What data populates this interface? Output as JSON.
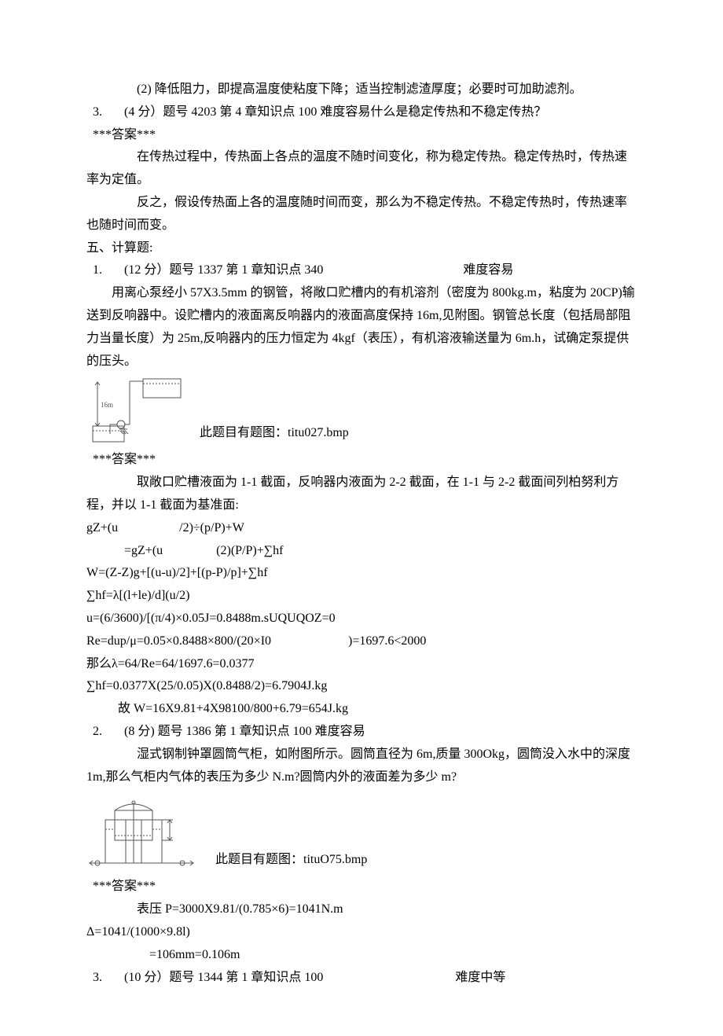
{
  "l1": "(2) 降低阻力，即提高温度使粘度下降；适当控制滤渣厚度；必要时可加助滤剂。",
  "q3": {
    "num": "3.",
    "head": "(4 分）题号 4203 第 4 章知识点 100 难度容易什么是稳定传热和不稳定传热？",
    "ans_lbl": "***答案***",
    "a1": "在传热过程中，传热面上各点的温度不随时间变化，称为稳定传热。稳定传热时，传热速率为定值。",
    "a2": "反之，假设传热面上各的温度随时间而变，那么为不稳定传热。不稳定传热时，传热速率也随时间而变。"
  },
  "sec5": "五、计算题:",
  "q1": {
    "num": "1.",
    "head_left": "(12 分）题号 1337 第 1 章知识点 340",
    "head_right": "难度容易",
    "body": "用离心泵经小 57X3.5mm 的钢管，将敞口贮槽内的有机溶剂（密度为 800kg.m，粘度为 20CP)输送到反响器中。设贮槽内的液面离反响器内的液面高度保持 16m,见附图。钢管总长度（包括局部阻力当量长度）为 25m,反响器内的压力恒定为 4kgf（表压），有机溶液输送量为 6m.h，试确定泵提供的压头。",
    "fig_cap": "此题目有题图：titu027.bmp",
    "ans_lbl": "***答案***",
    "a1": "取敞口贮槽液面为 1-1 截面，反响器内液面为 2-2 截面，在 1-1 与 2-2 截面间列柏努利方程，并以 1-1 截面为基准面:",
    "c1a": "gZ+(u",
    "c1b": "/2)÷(p/P)+W",
    "c2a": "=gZ+(u",
    "c2b": "(2)(P/P)+∑hf",
    "c3": "W=(Z-Z)g+[(u-u)/2]+[(p-P)/p]+∑hf",
    "c4": "∑hf=λ[(l+le)/d](u/2)",
    "c5": "u=(6/3600)/[(π/4)×0.05J=0.8488m.sUQUQOZ=0",
    "c6a": "Re=dup/μ=0.05×0.8488×800/(20×I0",
    "c6b": ")=1697.6<2000",
    "c7": "那么λ=64/Re=64/1697.6=0.0377",
    "c8": "∑hf=0.0377X(25/0.05)X(0.8488/2)=6.7904J.kg",
    "c9": "故 W=16X9.81+4X98100/800+6.79=654J.kg"
  },
  "q2": {
    "num": "2.",
    "head": "(8 分) 题号 1386 第 1 章知识点 100 难度容易",
    "body": "湿式钢制钟罩圆筒气柜，如附图所示。圆筒直径为 6m,质量 300Okg，圆筒没入水中的深度1m,那么气柜内气体的表压为多少 N.m?圆筒内外的液面差为多少 m?",
    "fig_cap": "此题目有题图：tituO75.bmp",
    "ans_lbl": "***答案***",
    "a1": "表压 P=3000X9.81/(0.785×6)=1041N.m",
    "a2": "Δ=1041/(1000×9.8l)",
    "a3": "=106mm=0.106m"
  },
  "q5_3": {
    "num": "3.",
    "head_left": "(10 分）题号 1344 第 1 章知识点 100",
    "head_right": "难度中等"
  }
}
